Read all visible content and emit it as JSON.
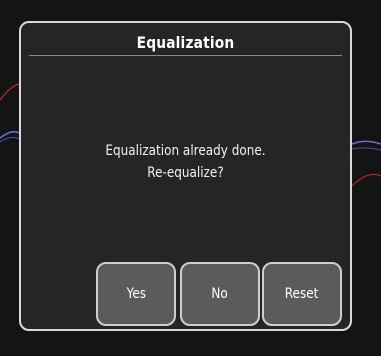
{
  "dialog": {
    "title": "Equalization",
    "message_line1": "Equalization already done.",
    "message_line2": "Re-equalize?"
  },
  "buttons": {
    "yes": "Yes",
    "no": "No",
    "reset": "Reset"
  },
  "colors": {
    "background": "#141414",
    "dialog_fill": "#262626",
    "dialog_border": "#d9d9d9",
    "button_fill": "#5b5b5b",
    "wave_red": "#c0262b",
    "wave_blue": "#6b6fd1",
    "wave_gray": "#7a7a7a"
  }
}
